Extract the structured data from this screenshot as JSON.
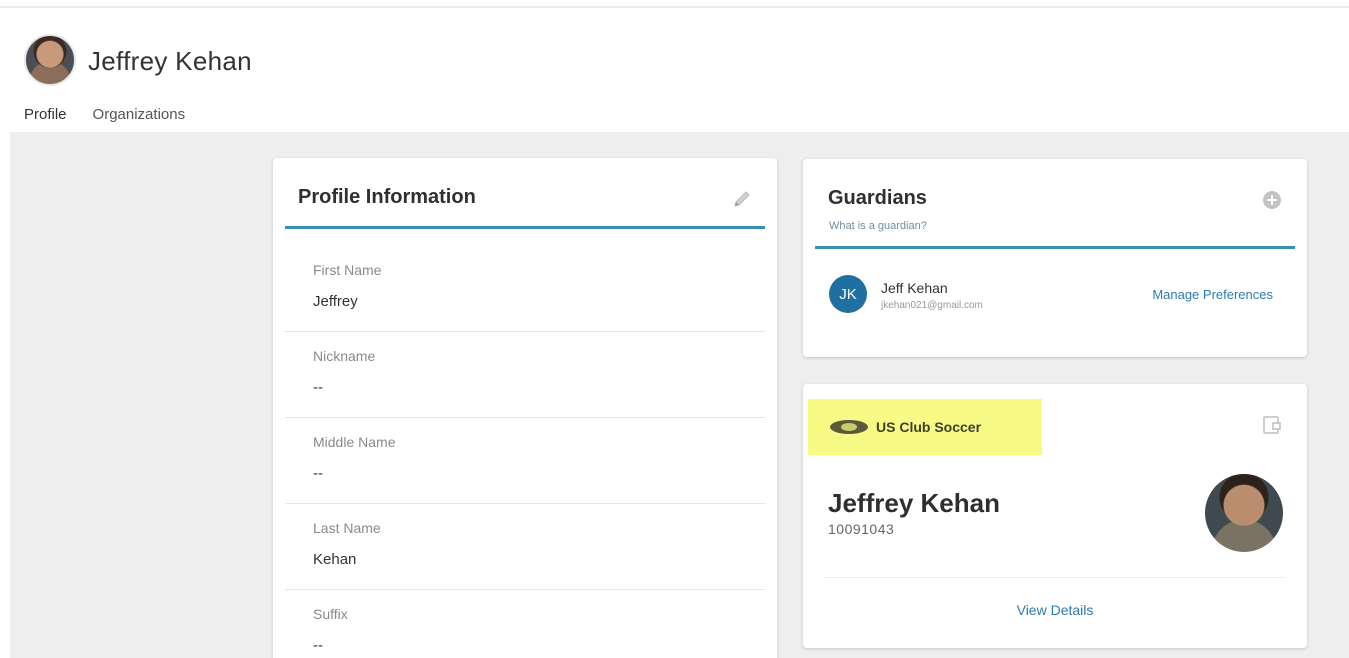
{
  "header": {
    "user_name": "Jeffrey Kehan"
  },
  "tabs": [
    {
      "label": "Profile",
      "active": true
    },
    {
      "label": "Organizations",
      "active": false
    }
  ],
  "profile_card": {
    "title": "Profile Information",
    "fields": [
      {
        "label": "First Name",
        "value": "Jeffrey"
      },
      {
        "label": "Nickname",
        "value": "--"
      },
      {
        "label": "Middle Name",
        "value": "--"
      },
      {
        "label": "Last Name",
        "value": "Kehan"
      },
      {
        "label": "Suffix",
        "value": "--"
      }
    ]
  },
  "guardians_card": {
    "title": "Guardians",
    "help_text": "What is a guardian?",
    "guardian": {
      "initials": "JK",
      "name": "Jeff Kehan",
      "email": "jkehan021@gmail.com"
    },
    "manage_label": "Manage Preferences"
  },
  "membership_card": {
    "org_name": "US Club Soccer",
    "member_name": "Jeffrey Kehan",
    "member_id": "10091043",
    "view_details_label": "View Details"
  },
  "colors": {
    "accent": "#3a8fb7",
    "link": "#2a7bb0",
    "highlight": "#f7fa85",
    "page_bg": "#eeeeee"
  }
}
